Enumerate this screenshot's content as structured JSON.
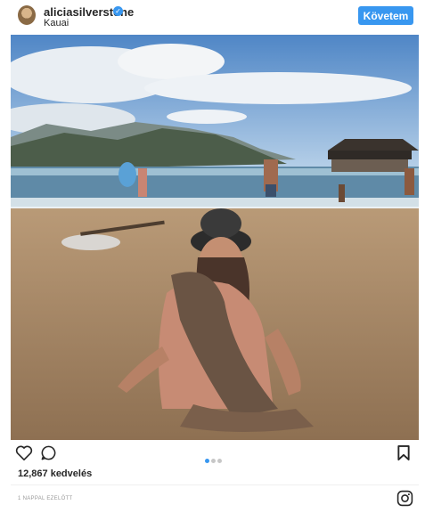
{
  "post": {
    "username": "aliciasilverstone",
    "location": "Kauai",
    "follow_label": "Követem",
    "likes_text": "12,867 kedvelés",
    "timestamp": "1 NAPPAL EZELŐTT",
    "carousel": {
      "count": 3,
      "active_index": 0
    }
  },
  "icons": {
    "verified": "verified-badge-icon",
    "like": "heart-icon",
    "comment": "comment-icon",
    "save": "bookmark-icon",
    "brand": "instagram-icon"
  },
  "colors": {
    "accent": "#3897f0",
    "text": "#262626",
    "muted": "#999999"
  }
}
